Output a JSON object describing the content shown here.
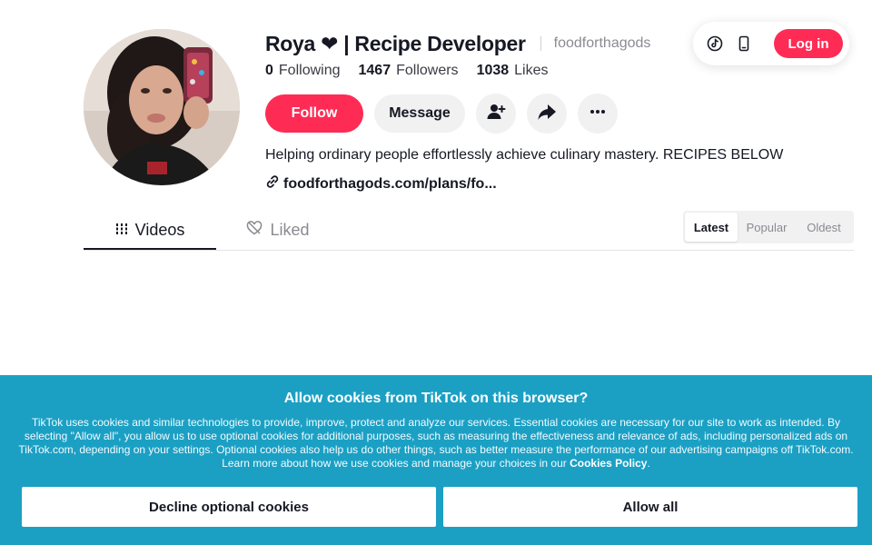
{
  "header": {
    "login_label": "Log in",
    "icons": [
      "tiktok-icon",
      "mobile-device-icon"
    ]
  },
  "profile": {
    "display_name": "Roya ❤ | Recipe Developer",
    "username": "foodforthagods",
    "stats": {
      "following_count": "0",
      "following_label": "Following",
      "followers_count": "1467",
      "followers_label": "Followers",
      "likes_count": "1038",
      "likes_label": "Likes"
    },
    "follow_label": "Follow",
    "message_label": "Message",
    "bio": "Helping ordinary people effortlessly achieve culinary mastery. RECIPES BELOW",
    "link": "foodforthagods.com/plans/fo..."
  },
  "tabs": {
    "videos_label": "Videos",
    "liked_label": "Liked"
  },
  "sort": {
    "latest": "Latest",
    "popular": "Popular",
    "oldest": "Oldest",
    "active": "Latest"
  },
  "cookies": {
    "title": "Allow cookies from TikTok on this browser?",
    "body": "TikTok uses cookies and similar technologies to provide, improve, protect and analyze our services. Essential cookies are necessary for our site to work as intended. By selecting \"Allow all\", you allow us to use optional cookies for additional purposes, such as measuring the effectiveness and relevance of ads, including personalized ads on TikTok.com, depending on your settings. Optional cookies also help us do other things, such as better measure the performance of our advertising campaigns off TikTok.com. Learn more about how we use cookies and manage your choices in our",
    "policy_link": "Cookies Policy",
    "body_end": ".",
    "decline_label": "Decline optional cookies",
    "allow_label": "Allow all"
  },
  "colors": {
    "accent": "#fe2c55",
    "banner": "#1ba0c4"
  }
}
